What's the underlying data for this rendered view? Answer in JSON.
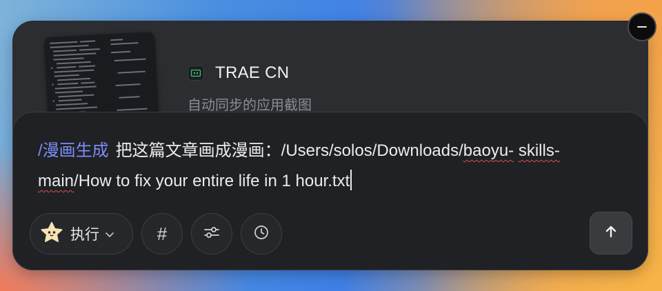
{
  "app": {
    "name": "TRAE CN",
    "subtitle": "自动同步的应用截图"
  },
  "prompt": {
    "command": "/漫画生成",
    "text_before": "把这篇文章画成漫画：/Users/solos/Downloads/",
    "flagged_1": "baoyu-",
    "flagged_2": "skills-main",
    "text_after": "/How to fix your entire life in 1 hour.txt"
  },
  "toolbar": {
    "mode_label": "执行",
    "hash_label": "#"
  },
  "icons": {
    "minimize": "minimize-icon",
    "app": "trae-logo-icon",
    "mode": "star-mascot-icon",
    "mode_chevron": "chevron-down-icon",
    "settings": "sliders-icon",
    "history": "clock-icon",
    "send": "arrow-up-icon"
  },
  "colors": {
    "panel": "#2b2d31",
    "input_card": "#202124",
    "command": "#7c8cf8",
    "app_icon_accent": "#39d37a",
    "spellcheck": "#d9534f"
  }
}
